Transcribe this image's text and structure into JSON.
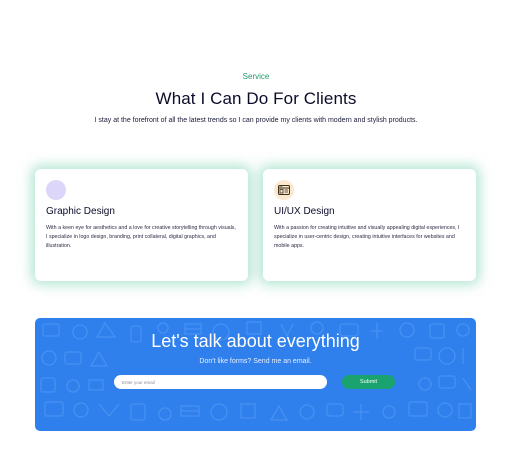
{
  "section": {
    "eyebrow": "Service",
    "title": "What I Can Do For Clients",
    "subtitle": "I stay at the forefront of all the latest trends so I can provide my clients with modern and stylish products."
  },
  "services": [
    {
      "icon": "palette-icon",
      "title": "Graphic Design",
      "description": "With a keen eye for aesthetics and a love for creative storytelling through visuals, I specialize in logo design, branding, print collateral, digital graphics, and illustration."
    },
    {
      "icon": "browser-window-icon",
      "title": "UI/UX Design",
      "description": "With a passion for creating intuitive and visually appealing digital experiences, I specialize in user-centric design, creating intuitive interfaces for websites and mobile apps."
    }
  ],
  "cta": {
    "heading": "Let's talk about everything",
    "subheading": "Don't like forms? Send me an email.",
    "email_placeholder": "Enter your email",
    "email_value": "",
    "submit_label": "Submit"
  },
  "colors": {
    "accent_green": "#1f9a6b",
    "cta_background": "#2f80ed",
    "submit_button": "#1aa36e",
    "card_glow": "#78d2af"
  }
}
